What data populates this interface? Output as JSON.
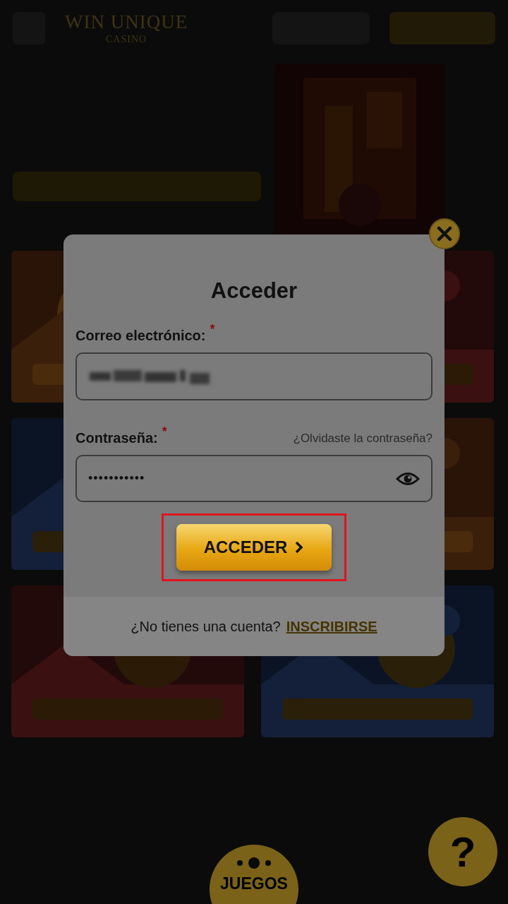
{
  "background_page": {
    "logo": {
      "title": "WIN UNIQUE",
      "subtitle": "CASINO"
    }
  },
  "login_dialog": {
    "title": "Acceder",
    "fields": [
      {
        "kind": "email",
        "label": "Correo electrónico:",
        "required_mark": "*"
      },
      {
        "kind": "password",
        "label": "Contraseña:",
        "required_mark": "*",
        "value": "•••••••••••",
        "link": "¿Olvidaste la contraseña?"
      }
    ],
    "submit": {
      "label": "ACCEDER",
      "highlighted": true
    },
    "footer": {
      "text": "¿No tienes una cuenta?",
      "link": "INSCRIBIRSE"
    }
  },
  "bottom_nav": {
    "games_button": "JUEGOS",
    "help_button": "?"
  }
}
